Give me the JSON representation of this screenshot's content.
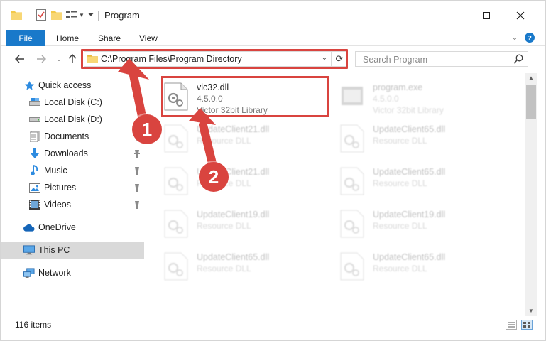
{
  "window": {
    "title": "Program",
    "controls": {
      "minimize": "—",
      "maximize": "☐",
      "close": "✕"
    }
  },
  "ribbon": {
    "file": "File",
    "home": "Home",
    "share": "Share",
    "view": "View"
  },
  "address": {
    "path": "C:\\Program Files\\Program Directory",
    "search_placeholder": "Search Program"
  },
  "sidebar": {
    "items": [
      {
        "label": "Quick access",
        "icon": "star-icon"
      },
      {
        "label": "Local Disk (C:)",
        "icon": "drive-icon"
      },
      {
        "label": "Local Disk (D:)",
        "icon": "drive-icon"
      },
      {
        "label": "Documents",
        "icon": "documents-icon"
      },
      {
        "label": "Downloads",
        "icon": "downloads-icon"
      },
      {
        "label": "Music",
        "icon": "music-icon"
      },
      {
        "label": "Pictures",
        "icon": "pictures-icon"
      },
      {
        "label": "Videos",
        "icon": "videos-icon"
      },
      {
        "label": "OneDrive",
        "icon": "cloud-icon"
      },
      {
        "label": "This PC",
        "icon": "computer-icon"
      },
      {
        "label": "Network",
        "icon": "network-icon"
      }
    ]
  },
  "files": [
    {
      "name": "vic32.dll",
      "version": "4.5.0.0",
      "description": "Victor 32bit Library"
    },
    {
      "name": "program.exe",
      "version": "4.5.0.0",
      "description": "Victor 32bit Library"
    },
    {
      "name": "UpdateClient21.dll",
      "description": "Resource DLL"
    },
    {
      "name": "UpdateClient65.dll",
      "description": "Resource DLL"
    },
    {
      "name": "UpdateClient21.dll",
      "description": "Resource DLL"
    },
    {
      "name": "UpdateClient65.dll",
      "description": "Resource DLL"
    },
    {
      "name": "UpdateClient19.dll",
      "description": "Resource DLL"
    },
    {
      "name": "UpdateClient19.dll",
      "description": "Resource DLL"
    },
    {
      "name": "UpdateClient65.dll",
      "description": "Resource DLL"
    },
    {
      "name": "UpdateClient65.dll",
      "description": "Resource DLL"
    }
  ],
  "status": {
    "item_count": "116 items"
  },
  "annotations": {
    "step1": "1",
    "step2": "2"
  },
  "colors": {
    "accent": "#1979ca",
    "highlight": "#d9443f",
    "selection": "#d9d9d9"
  }
}
